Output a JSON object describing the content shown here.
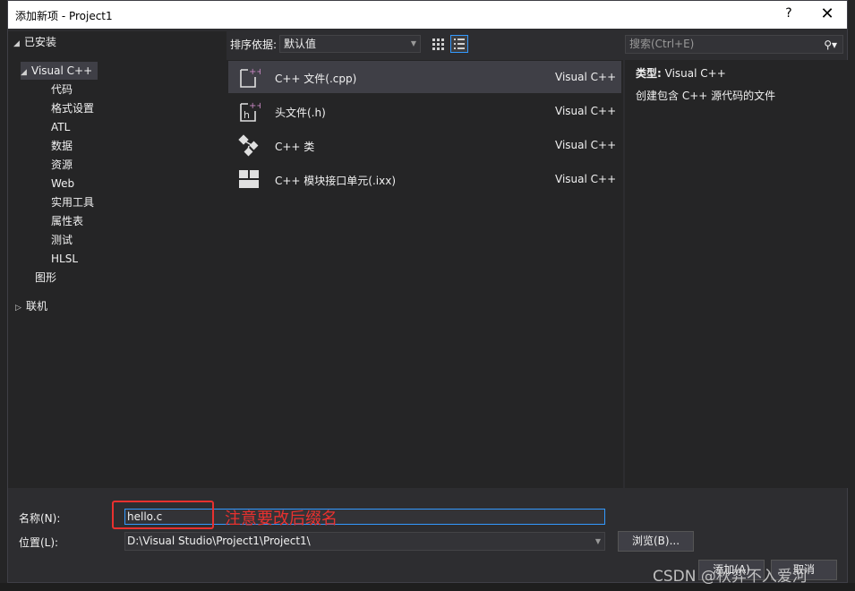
{
  "window": {
    "title": "添加新项 - Project1",
    "help_label": "?",
    "close_label": "✕"
  },
  "tree": {
    "installed_label": "已安装",
    "visual_cpp_label": "Visual C++",
    "children": [
      "代码",
      "格式设置",
      "ATL",
      "数据",
      "资源",
      "Web",
      "实用工具",
      "属性表",
      "测试",
      "HLSL"
    ],
    "graphics_label": "图形",
    "online_label": "联机"
  },
  "toolbar": {
    "sort_label": "排序依据:",
    "sort_value": "默认值",
    "search_placeholder": "搜索(Ctrl+E)"
  },
  "templates": [
    {
      "name": "C++ 文件(.cpp)",
      "language": "Visual C++",
      "icon": "cpp-file-icon"
    },
    {
      "name": "头文件(.h)",
      "language": "Visual C++",
      "icon": "header-file-icon"
    },
    {
      "name": "C++ 类",
      "language": "Visual C++",
      "icon": "class-icon"
    },
    {
      "name": "C++ 模块接口单元(.ixx)",
      "language": "Visual C++",
      "icon": "module-icon"
    }
  ],
  "detail": {
    "type_label": "类型:",
    "type_value": "Visual C++",
    "description": "创建包含 C++ 源代码的文件"
  },
  "form": {
    "name_label": "名称(N):",
    "name_value": "hello.c",
    "location_label": "位置(L):",
    "location_value": "D:\\Visual Studio\\Project1\\Project1\\",
    "browse_label": "浏览(B)...",
    "add_label": "添加(A)",
    "cancel_label": "取消"
  },
  "annotation": {
    "text": "注意要改后缀名",
    "color": "#e8312f"
  },
  "watermark": "CSDN @秋弈不入爱河",
  "colors": {
    "accent": "#3399ff",
    "dialog_bg": "#2d2d30",
    "panel_bg": "#252526",
    "selection": "#3f3f46",
    "icon_purple": "#c586c0"
  }
}
